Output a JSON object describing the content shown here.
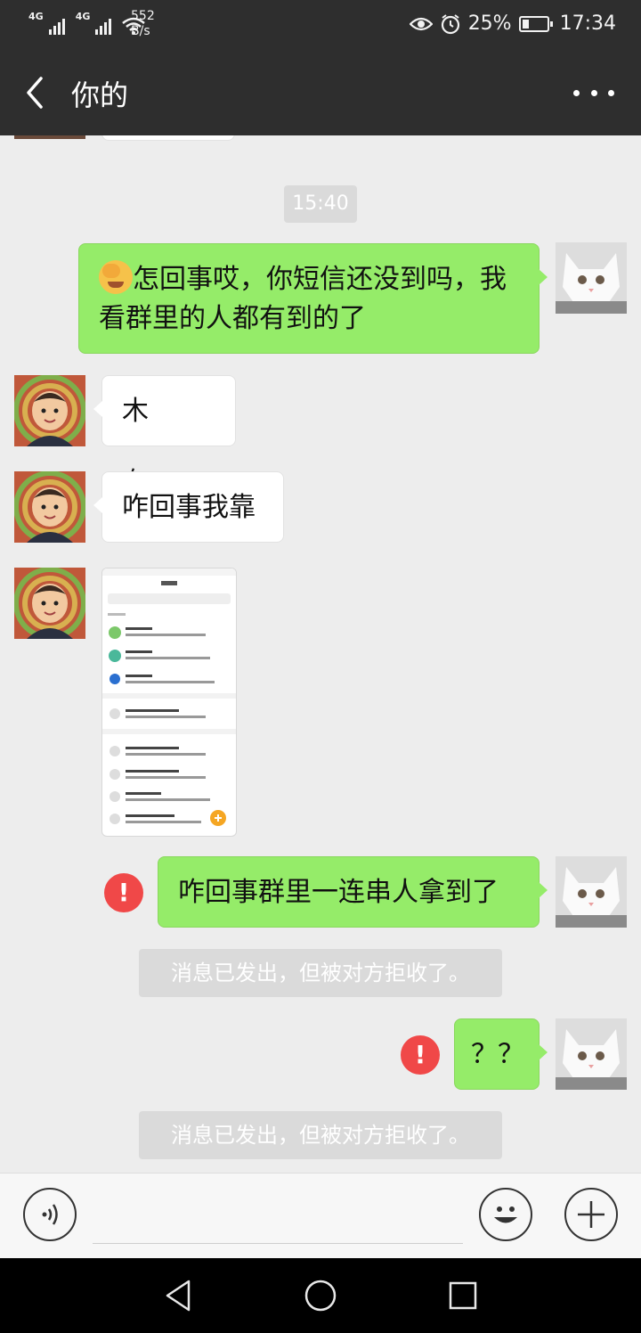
{
  "status_bar": {
    "network_1": "4G",
    "network_2": "4G",
    "speed_value": "552",
    "speed_unit": "B/s",
    "battery_percent": "25%",
    "battery_level": 0.25,
    "time": "17:34"
  },
  "header": {
    "title": "你的"
  },
  "chat": {
    "timestamp": "15:40",
    "messages": [
      {
        "side": "sent",
        "emoji": "facepalm",
        "text": "怎回事哎，你短信还没到吗，我看群里的人都有到的了"
      },
      {
        "side": "received",
        "text": "木有……"
      },
      {
        "side": "received",
        "text": "咋回事我靠"
      },
      {
        "side": "received",
        "type": "image",
        "content": "sms screenshot"
      },
      {
        "side": "sent",
        "failed": true,
        "text": "咋回事群里一连串人拿到了"
      },
      {
        "side": "system",
        "text": "消息已发出，但被对方拒收了。"
      },
      {
        "side": "sent",
        "failed": true,
        "text": "？？"
      },
      {
        "side": "system",
        "text": "消息已发出，但被对方拒收了。"
      }
    ],
    "error_mark": "!"
  },
  "input_bar": {
    "voice_icon": "voice-icon",
    "emoji_icon": "emoji-icon",
    "plus_icon": "plus-icon"
  },
  "colors": {
    "sent_bubble": "#95ec69",
    "received_bubble": "#ffffff",
    "header_bg": "#2e2e2e",
    "error": "#f04848",
    "chat_bg": "#ededed"
  }
}
